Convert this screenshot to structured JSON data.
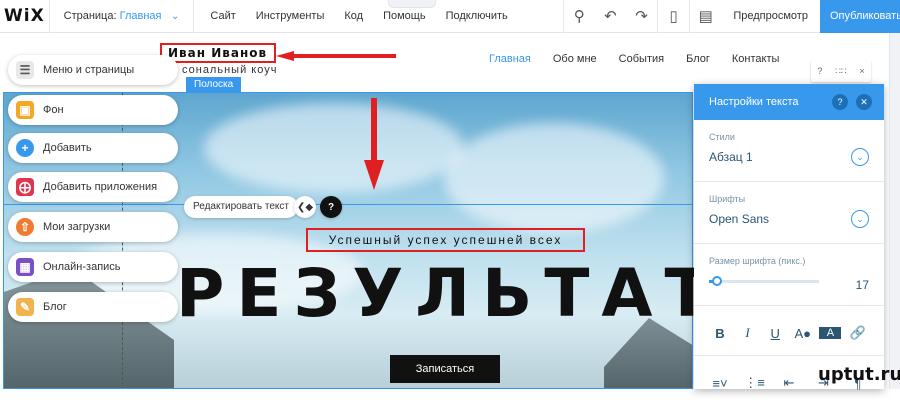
{
  "topbar": {
    "logo": "WiX",
    "page_label": "Страница:",
    "page_value": "Главная",
    "menu": [
      "Сайт",
      "Инструменты",
      "Код",
      "Помощь",
      "Подключить премиум"
    ],
    "preview": "Предпросмотр",
    "publish": "Опубликовать"
  },
  "site": {
    "name": "Иван Иванов",
    "subtitle": "сональный коуч",
    "nav": [
      "Главная",
      "Обо мне",
      "События",
      "Блог",
      "Контакты"
    ],
    "strip_tag": "Полоска",
    "edit_text": "Редактировать текст",
    "tagline": "Успешный успех успешней всех",
    "headline": "РЕЗУЛЬТАТ",
    "signup": "Записаться"
  },
  "sidemenu": [
    {
      "label": "Меню и страницы",
      "icon": "pages-icon",
      "color": "#e8e8e8"
    },
    {
      "label": "Фон",
      "icon": "background-icon",
      "color": "#f5a623"
    },
    {
      "label": "Добавить",
      "icon": "add-icon",
      "color": "#3899ec"
    },
    {
      "label": "Добавить приложения",
      "icon": "apps-icon",
      "color": "#e0344f"
    },
    {
      "label": "Мои загрузки",
      "icon": "upload-icon",
      "color": "#f07a31"
    },
    {
      "label": "Онлайн-запись",
      "icon": "calendar-icon",
      "color": "#7a4fc8"
    },
    {
      "label": "Блог",
      "icon": "pen-icon",
      "color": "#f1b34c"
    }
  ],
  "panel": {
    "title": "Настройки текста",
    "styles_label": "Стили",
    "styles_value": "Абзац 1",
    "fonts_label": "Шрифты",
    "fonts_value": "Open Sans",
    "size_label": "Размер шрифта (пикс.)",
    "size_value": "17",
    "size_fraction": 0.06
  },
  "watermark": "uptut.ru"
}
